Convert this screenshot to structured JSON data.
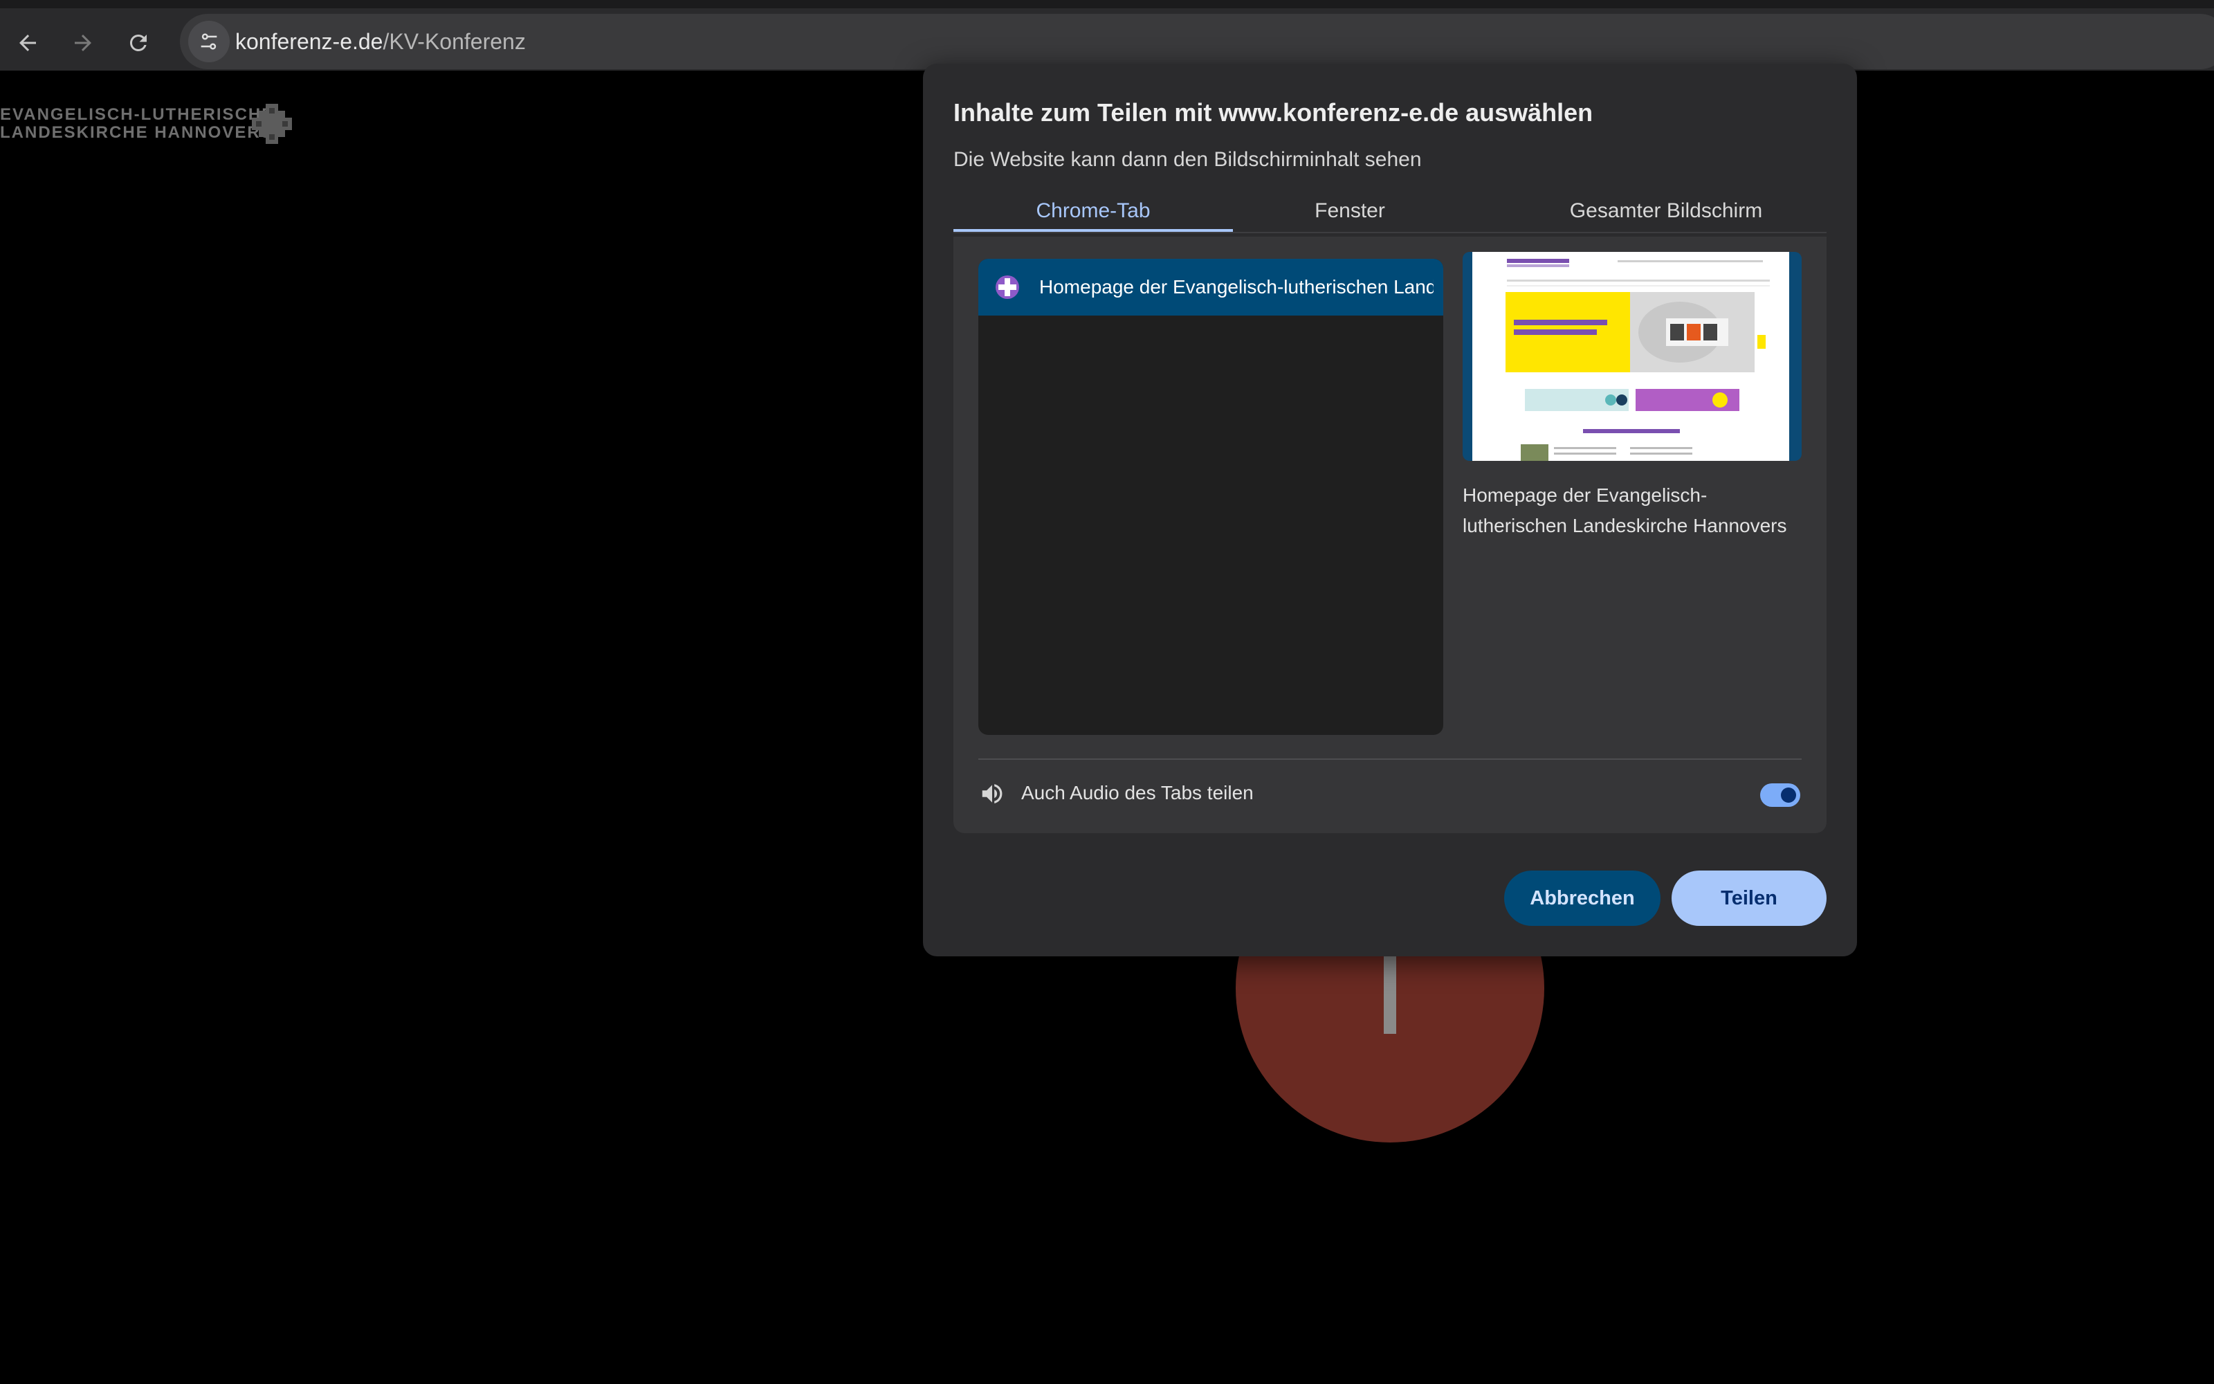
{
  "browser": {
    "url_host": "konferenz-e.de",
    "url_path": "/KV-Konferenz",
    "icons": [
      "back-arrow-icon",
      "forward-arrow-icon",
      "reload-icon",
      "site-settings-icon"
    ]
  },
  "page": {
    "logo_line1": "EVANGELISCH-LUTHERISCHE",
    "logo_line2": "LANDESKIRCHE HANNOVERS"
  },
  "dialog": {
    "title": "Inhalte zum Teilen mit www.konferenz-e.de auswählen",
    "subtitle": "Die Website kann dann den Bildschirminhalt sehen",
    "tabs": [
      {
        "label": "Chrome-Tab",
        "active": true
      },
      {
        "label": "Fenster",
        "active": false
      },
      {
        "label": "Gesamter Bildschirm",
        "active": false
      }
    ],
    "tab_list": [
      {
        "label": "Homepage der Evangelisch-lutherischen Landeskirche Hannovers",
        "selected": true
      }
    ],
    "preview_caption": "Homepage der Evangelisch-lutherischen Landeskirche Hannovers",
    "audio_label": "Auch Audio des Tabs teilen",
    "audio_enabled": true,
    "cancel_label": "Abbrechen",
    "share_label": "Teilen"
  },
  "colors": {
    "accent": "#a8c7fa",
    "selected_row": "#004a77",
    "dialog_bg": "#2b2b2d"
  }
}
